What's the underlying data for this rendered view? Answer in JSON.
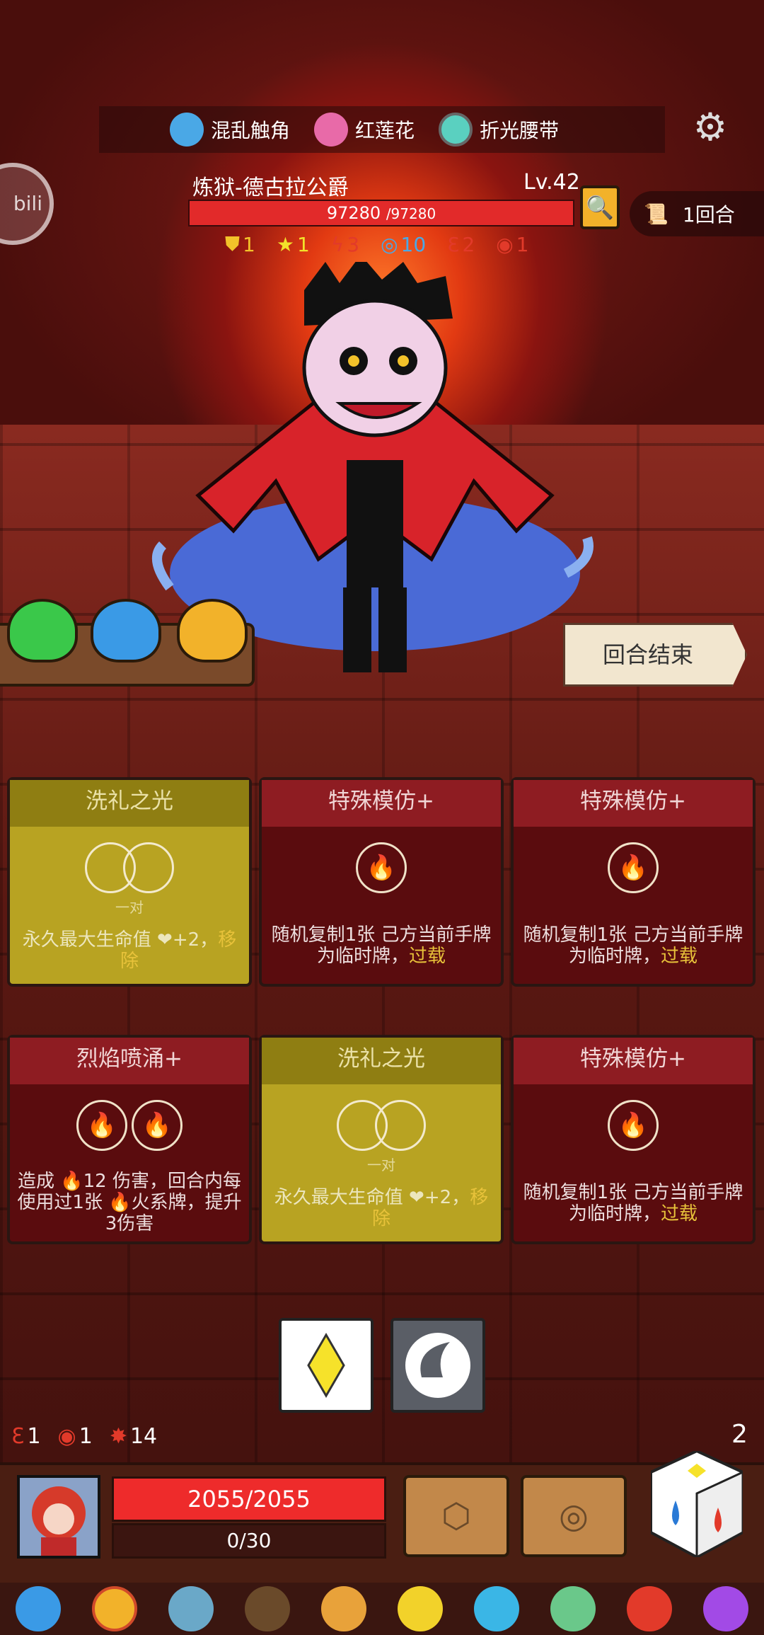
{
  "relics": [
    {
      "label": "混乱触角",
      "icon": "tentacle-icon",
      "color": "#4aa8e6"
    },
    {
      "label": "红莲花",
      "icon": "lotus-icon",
      "color": "#e86aa8"
    },
    {
      "label": "折光腰带",
      "icon": "belt-icon",
      "color": "#5ad0c0"
    }
  ],
  "boss": {
    "name": "炼狱-德古拉公爵",
    "level": "Lv.42",
    "hp": "97280",
    "hp_max": "/97280",
    "status": [
      {
        "icon": "shield-icon",
        "value": "1",
        "color": "#f2c22a"
      },
      {
        "icon": "star-icon",
        "value": "1",
        "color": "#f2e22a"
      },
      {
        "icon": "bolt-icon",
        "value": "3",
        "color": "#e23a2a"
      },
      {
        "icon": "spiral-icon",
        "value": "10",
        "color": "#4aa8e6"
      },
      {
        "icon": "claw-icon",
        "value": "2",
        "color": "#e23a2a"
      },
      {
        "icon": "target-icon",
        "value": "1",
        "color": "#e23a2a"
      }
    ]
  },
  "round": {
    "label": "1回合"
  },
  "bili_label": "bili",
  "end_turn": "回合结束",
  "cards": [
    {
      "title": "洗礼之光",
      "style": "gold",
      "sub": "一对",
      "desc": "永久最大生命值 ❤+2，",
      "hl": "移除"
    },
    {
      "title": "特殊模仿+",
      "style": "red",
      "desc": "随机复制1张 己方当前手牌 为临时牌，",
      "hl": "过载"
    },
    {
      "title": "特殊模仿+",
      "style": "red",
      "desc": "随机复制1张 己方当前手牌 为临时牌，",
      "hl": "过载"
    },
    {
      "title": "烈焰喷涌+",
      "style": "red",
      "desc": "造成 🔥12 伤害，回合内每使用过1张 🔥火系牌，提升3伤害",
      "hl": ""
    },
    {
      "title": "洗礼之光",
      "style": "gold",
      "sub": "一对",
      "desc": "永久最大生命值 ❤+2，",
      "hl": "移除"
    },
    {
      "title": "特殊模仿+",
      "style": "red",
      "desc": "随机复制1张 己方当前手牌 为临时牌，",
      "hl": "过载"
    }
  ],
  "player": {
    "hp": "2055/2055",
    "exp": "0/30",
    "status": [
      {
        "icon": "claw-icon",
        "value": "1"
      },
      {
        "icon": "target-icon",
        "value": "1"
      },
      {
        "icon": "burst-icon",
        "value": "14"
      }
    ],
    "dice_count": "2"
  },
  "colors": {
    "accent": "#e22a2a",
    "gold": "#b8a322",
    "card_red": "#5a0c0e"
  },
  "items": [
    "blue-creature-icon",
    "ring-icon",
    "axe-icon",
    "scarecrow-icon",
    "lion-icon",
    "helmet-icon",
    "gem-icon",
    "leaf-orb-icon",
    "fire-icon",
    "potion-icon"
  ]
}
